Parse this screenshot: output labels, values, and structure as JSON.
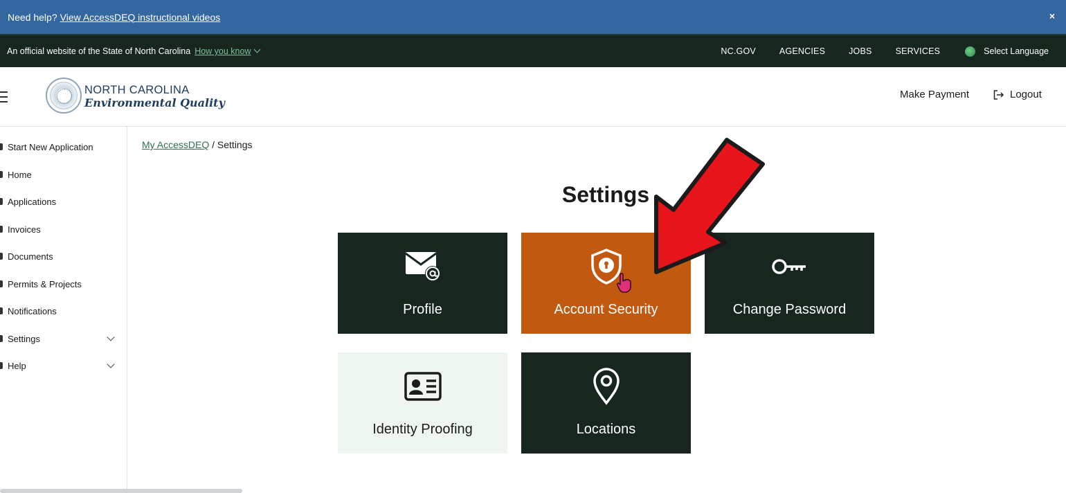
{
  "banner": {
    "prefix": "Need help?",
    "link": "View AccessDEQ instructional videos",
    "close": "×"
  },
  "official_bar": {
    "text": "An official website of the State of North Carolina",
    "how_link": "How you know",
    "nav": [
      "NC.GOV",
      "AGENCIES",
      "JOBS",
      "SERVICES"
    ],
    "language": "Select Language"
  },
  "header": {
    "brand_top": "NORTH CAROLINA",
    "brand_bottom": "Environmental Quality",
    "make_payment": "Make Payment",
    "logout": "Logout"
  },
  "sidebar": {
    "items": [
      {
        "label": "Start New Application"
      },
      {
        "label": "Home"
      },
      {
        "label": "Applications"
      },
      {
        "label": "Invoices"
      },
      {
        "label": "Documents"
      },
      {
        "label": "Permits & Projects"
      },
      {
        "label": "Notifications"
      },
      {
        "label": "Settings"
      },
      {
        "label": "Help"
      }
    ]
  },
  "breadcrumb": {
    "link": "My AccessDEQ",
    "separator": "/",
    "current": "Settings"
  },
  "main": {
    "title": "Settings",
    "tiles": [
      {
        "label": "Profile",
        "icon": "envelope-at-icon"
      },
      {
        "label": "Account Security",
        "icon": "shield-lock-icon"
      },
      {
        "label": "Change Password",
        "icon": "key-icon"
      },
      {
        "label": "Identity Proofing",
        "icon": "id-card-icon"
      },
      {
        "label": "Locations",
        "icon": "map-pin-icon"
      }
    ]
  },
  "colors": {
    "banner_blue": "#34679f",
    "dark_green": "#17261f",
    "accent_orange": "#c15a10",
    "light_tile": "#eef6ef",
    "arrow_red": "#e8141c"
  }
}
